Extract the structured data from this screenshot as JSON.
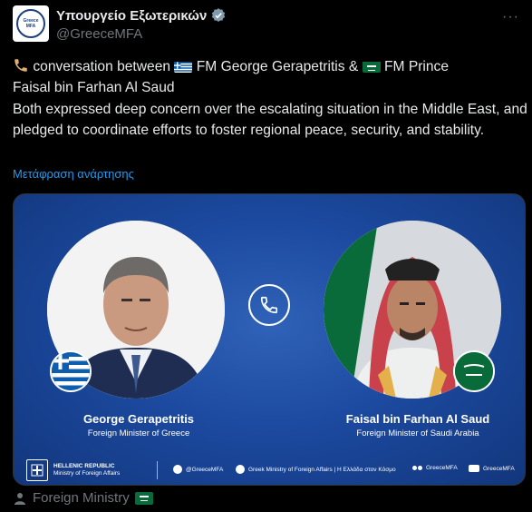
{
  "account": {
    "display_name": "Υπουργείο Εξωτερικών",
    "handle": "@GreeceMFA",
    "avatar_text": "Greece MFA",
    "more_label": "···"
  },
  "tweet": {
    "line1_prefix": "conversation between",
    "fm_greece": "FM George Gerapetritis &",
    "fm_saudi_a": "FM Prince",
    "line2": "Faisal bin Farhan Al Saud",
    "body": "Both expressed deep concern over the escalating situation in the Middle East, and pledged to coordinate efforts to foster regional peace, security, and stability.",
    "translate_label": "Μετάφραση ανάρτησης"
  },
  "card": {
    "left_name": "George Gerapetritis",
    "left_role": "Foreign Minister of Greece",
    "right_name": "Faisal bin Farhan Al Saud",
    "right_role": "Foreign Minister of Saudi Arabia",
    "footer": {
      "hr_line1": "HELLENIC REPUBLIC",
      "hr_line2": "Ministry of Foreign Affairs",
      "twitter": "@GreeceMFA",
      "facebook": "Greek Ministry of Foreign Affairs | Η Ελλάδα στον Κόσμο",
      "flickr": "GreeceMFA",
      "youtube": "GreeceMFA"
    }
  },
  "attribution": {
    "label": "Foreign Ministry"
  },
  "colors": {
    "link": "#1d9bf0",
    "muted": "#71767b",
    "text": "#e7e9ea",
    "card_blue": "#1c4aa0",
    "saudi_green": "#0a6b3a",
    "greek_blue": "#0d5eaf"
  },
  "icons": [
    "verified-badge-icon",
    "more-icon",
    "phone-icon",
    "greek-flag-icon",
    "saudi-flag-icon",
    "twitter-icon",
    "facebook-icon",
    "flickr-icon",
    "youtube-icon",
    "person-icon"
  ]
}
